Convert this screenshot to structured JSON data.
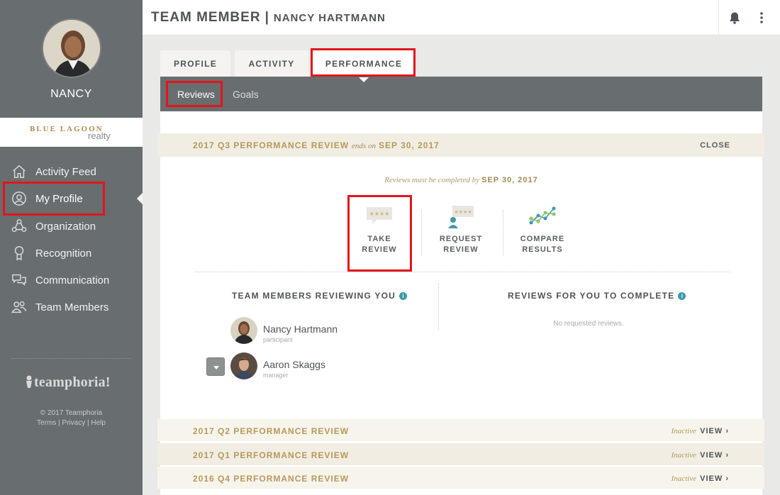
{
  "sidebar": {
    "user_name": "NANCY",
    "brand": {
      "name": "BLUE LAGOON",
      "sub": "realty"
    },
    "nav": [
      {
        "label": "Activity Feed",
        "icon": "home-icon"
      },
      {
        "label": "My Profile",
        "icon": "user-circle-icon"
      },
      {
        "label": "Organization",
        "icon": "org-icon"
      },
      {
        "label": "Recognition",
        "icon": "award-icon"
      },
      {
        "label": "Communication",
        "icon": "chat-icon"
      },
      {
        "label": "Team Members",
        "icon": "users-icon"
      }
    ],
    "footer": {
      "logo": "teamphoria!",
      "copyright": "© 2017 Teamphoria",
      "links": "Terms | Privacy | Help"
    }
  },
  "header": {
    "title": "TEAM MEMBER",
    "separator": "|",
    "subtitle": "NANCY HARTMANN"
  },
  "tabs": [
    {
      "label": "PROFILE"
    },
    {
      "label": "ACTIVITY"
    },
    {
      "label": "PERFORMANCE",
      "active": true
    }
  ],
  "subtabs": [
    {
      "label": "Reviews",
      "active": true
    },
    {
      "label": "Goals"
    }
  ],
  "current_review": {
    "title": "2017 Q3 PERFORMANCE REVIEW",
    "ends_label": "ends on",
    "ends_date": "SEP 30, 2017",
    "close_label": "CLOSE",
    "deadline_text": "Reviews must be completed by",
    "deadline_date": "SEP 30, 2017",
    "actions": [
      {
        "line1": "TAKE",
        "line2": "REVIEW"
      },
      {
        "line1": "REQUEST",
        "line2": "REVIEW"
      },
      {
        "line1": "COMPARE",
        "line2": "RESULTS"
      }
    ],
    "reviewing_you": {
      "heading": "TEAM MEMBERS REVIEWING YOU",
      "members": [
        {
          "name": "Nancy Hartmann",
          "role": "participant"
        },
        {
          "name": "Aaron Skaggs",
          "role": "manager"
        }
      ]
    },
    "to_complete": {
      "heading": "REVIEWS FOR YOU TO COMPLETE",
      "empty_text": "No requested reviews."
    }
  },
  "past_reviews": [
    {
      "title": "2017 Q2 PERFORMANCE REVIEW",
      "status": "Inactive",
      "action": "VIEW ›"
    },
    {
      "title": "2017 Q1 PERFORMANCE REVIEW",
      "status": "Inactive",
      "action": "VIEW ›"
    },
    {
      "title": "2016 Q4 PERFORMANCE REVIEW",
      "status": "Inactive",
      "action": "VIEW ›"
    }
  ],
  "colors": {
    "gold": "#b8985a",
    "sidebar": "#686d6f",
    "highlight": "#e3141b",
    "info": "#3d9aa8"
  }
}
